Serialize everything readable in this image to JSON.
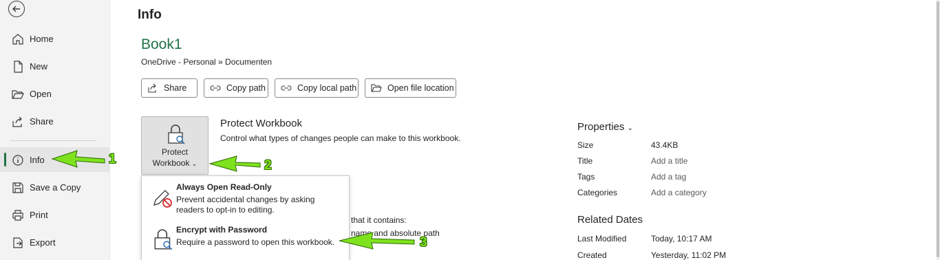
{
  "page": {
    "title": "Info"
  },
  "sidebar": {
    "back_icon": "back-arrow-icon",
    "items": [
      {
        "label": "Home",
        "icon": "home-icon"
      },
      {
        "label": "New",
        "icon": "new-document-icon"
      },
      {
        "label": "Open",
        "icon": "folder-open-icon"
      },
      {
        "label": "Share",
        "icon": "share-icon"
      },
      {
        "label": "Info",
        "icon": "info-icon",
        "active": true
      },
      {
        "label": "Save a Copy",
        "icon": "save-icon"
      },
      {
        "label": "Print",
        "icon": "print-icon"
      },
      {
        "label": "Export",
        "icon": "export-icon"
      }
    ]
  },
  "document": {
    "title": "Book1",
    "path": "OneDrive - Personal » Documenten"
  },
  "actions": {
    "share": "Share",
    "copy_path": "Copy path",
    "copy_local_path": "Copy local path",
    "open_file_location": "Open file location"
  },
  "protect": {
    "button_line1": "Protect",
    "button_line2": "Workbook",
    "title": "Protect Workbook",
    "description": "Control what types of changes people can make to this workbook."
  },
  "background_text": {
    "line1": "that it contains:",
    "line2": "name and absolute path"
  },
  "dropdown": {
    "items": [
      {
        "title": "Always Open Read-Only",
        "desc1": "Prevent accidental changes by asking",
        "desc2": "readers to opt-in to editing.",
        "icon": "pencil-prohibited-icon"
      },
      {
        "title": "Encrypt with Password",
        "desc1": "Require a password to open this workbook.",
        "icon": "lock-key-icon"
      }
    ]
  },
  "properties": {
    "header": "Properties",
    "rows": [
      {
        "key": "Size",
        "value": "43.4KB"
      },
      {
        "key": "Title",
        "value": "Add a title"
      },
      {
        "key": "Tags",
        "value": "Add a tag"
      },
      {
        "key": "Categories",
        "value": "Add a category"
      }
    ]
  },
  "related_dates": {
    "header": "Related Dates",
    "rows": [
      {
        "key": "Last Modified",
        "value": "Today, 10:17 AM"
      },
      {
        "key": "Created",
        "value": "Yesterday, 11:02 PM"
      }
    ]
  },
  "annotations": {
    "n1": "1",
    "n2": "2",
    "n3": "3",
    "arrow_color": "#7fe21f"
  },
  "colors": {
    "accent": "#217346"
  }
}
